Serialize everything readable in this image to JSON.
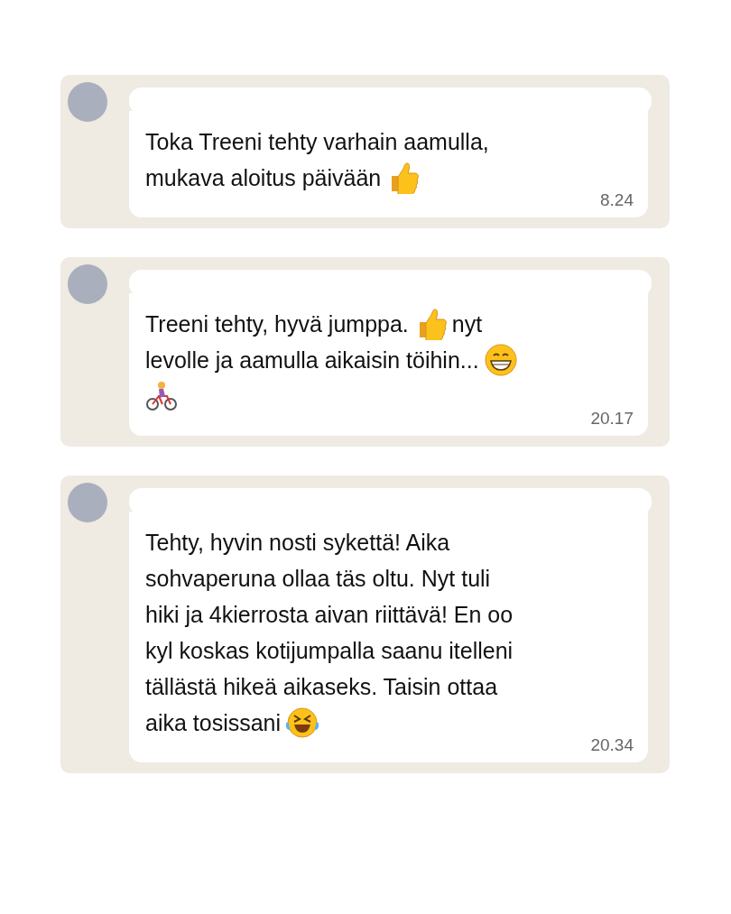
{
  "messages": [
    {
      "lines": [
        [
          {
            "kind": "text",
            "text": "Toka Treeni tehty varhain aamulla,"
          }
        ],
        [
          {
            "kind": "text",
            "text": "mukava aloitus päivään"
          },
          {
            "kind": "thumbs"
          }
        ]
      ],
      "time": "8.24"
    },
    {
      "lines": [
        [
          {
            "kind": "text",
            "text": "Treeni tehty, hyvä jumppa."
          },
          {
            "kind": "thumbs"
          },
          {
            "kind": "text",
            "text": "nyt"
          }
        ],
        [
          {
            "kind": "text",
            "text": "levolle ja aamulla aikaisin töihin..."
          },
          {
            "kind": "grin"
          }
        ],
        [
          {
            "kind": "cyclist"
          }
        ]
      ],
      "time": "20.17"
    },
    {
      "lines": [
        [
          {
            "kind": "text",
            "text": "Tehty, hyvin nosti sykettä! Aika"
          }
        ],
        [
          {
            "kind": "text",
            "text": "sohvaperuna ollaa täs oltu. Nyt tuli"
          }
        ],
        [
          {
            "kind": "text",
            "text": "hiki ja 4kierrosta aivan riittävä! En oo"
          }
        ],
        [
          {
            "kind": "text",
            "text": "kyl koskas kotijumpalla saanu itelleni"
          }
        ],
        [
          {
            "kind": "text",
            "text": "tällästä hikeä aikaseks. Taisin ottaa"
          }
        ],
        [
          {
            "kind": "text",
            "text": "aika tosissani"
          },
          {
            "kind": "laugh"
          }
        ]
      ],
      "time": "20.34"
    }
  ]
}
